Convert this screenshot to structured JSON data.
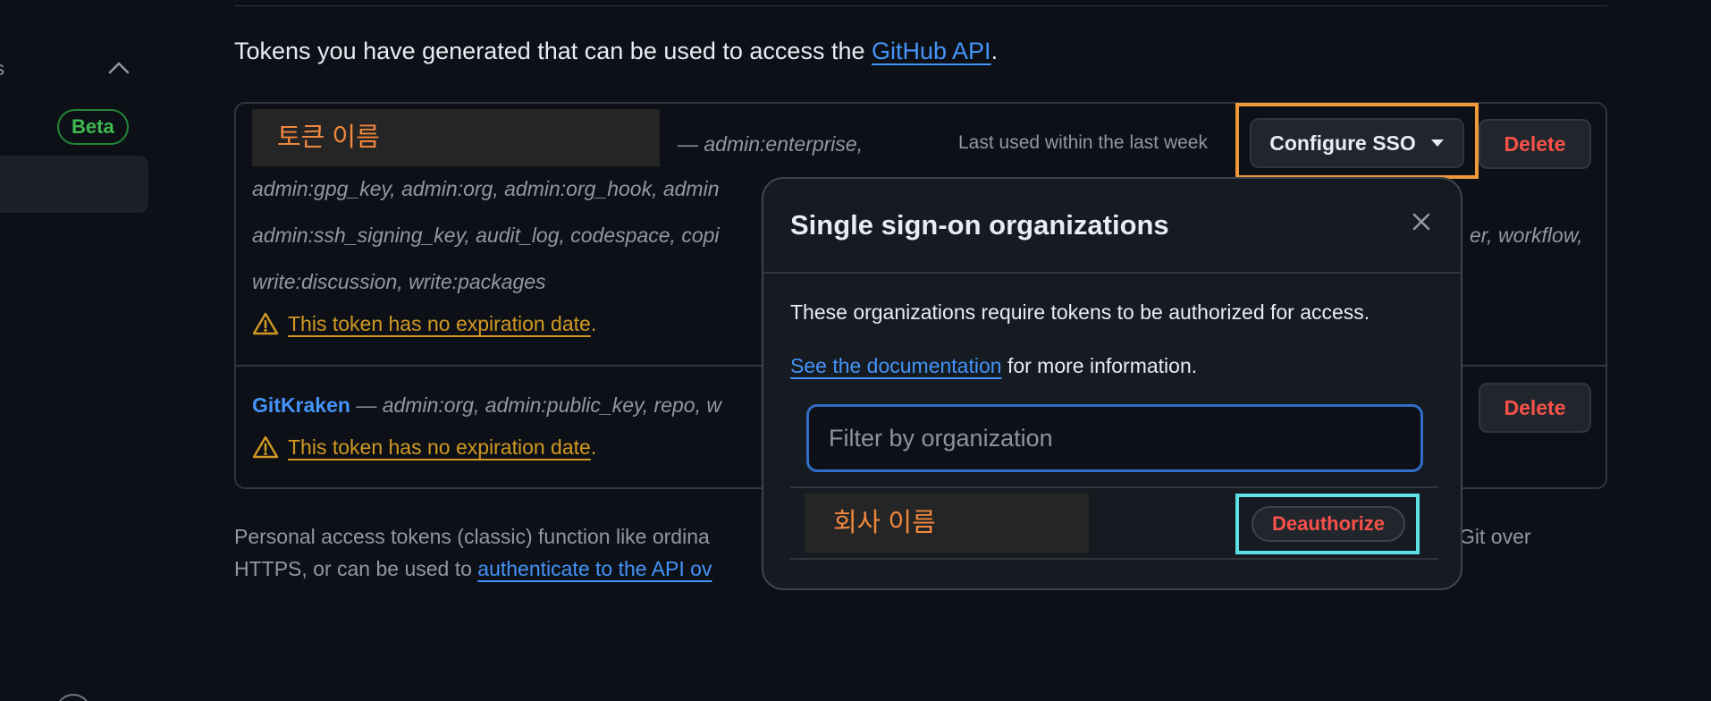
{
  "intro": {
    "text": "Tokens you have generated that can be used to access the ",
    "link": "GitHub API",
    "period": "."
  },
  "sidebar": {
    "glyph": "s",
    "badge": "Beta"
  },
  "tokens": [
    {
      "name": "토큰 이름",
      "scopes_line1": "— admin:enterprise,",
      "scopes_line2": "admin:gpg_key, admin:org, admin:org_hook, admin",
      "scopes_line3": "admin:ssh_signing_key, audit_log, codespace, copi",
      "scopes_line3_tail": "er, workflow,",
      "scopes_line4": "write:discussion, write:packages",
      "last_used": "Last used within the last week",
      "configure_label": "Configure SSO",
      "delete_label": "Delete",
      "warning": "This token has no expiration date",
      "warning_period": "."
    },
    {
      "name": "GitKraken",
      "scopes": " — admin:org, admin:public_key, repo, w",
      "delete_label": "Delete",
      "warning": "This token has no expiration date",
      "warning_period": "."
    }
  ],
  "footer": {
    "line1": "Personal access tokens (classic) function like ordina",
    "line1_tail": "Git over",
    "line2": "HTTPS, or can be used to ",
    "line2_link": "authenticate to the API ov"
  },
  "popover": {
    "title": "Single sign-on organizations",
    "description": "These organizations require tokens to be authorized for access.",
    "doc_link": "See the documentation",
    "doc_tail": " for more information.",
    "filter_placeholder": "Filter by organization",
    "org_name": "회사 이름",
    "deauthorize_label": "Deauthorize"
  },
  "colors": {
    "background": "#0d1117",
    "link": "#4493f8",
    "danger": "#f85149",
    "warning": "#d29922",
    "highlight_orange": "#f0993a",
    "highlight_cyan": "#5ce1e6"
  }
}
